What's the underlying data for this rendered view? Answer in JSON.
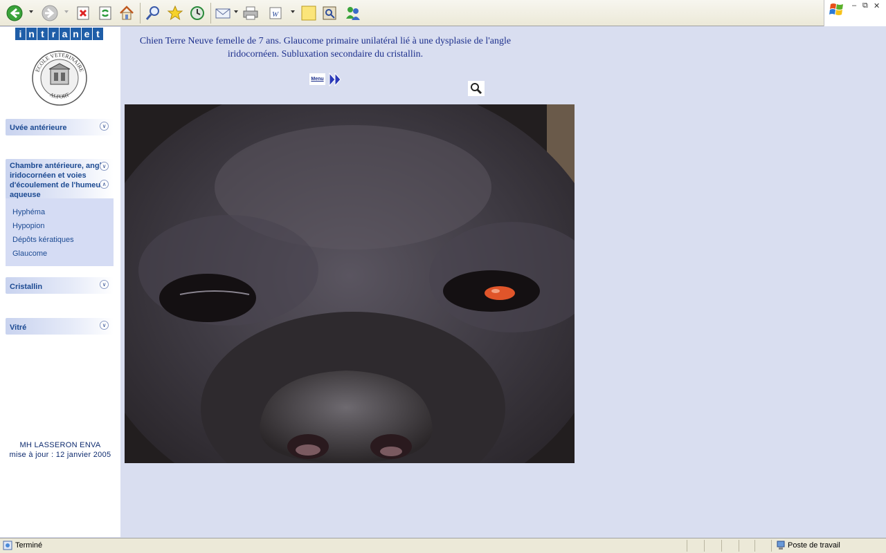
{
  "toolbar": {
    "buttons": [
      "back-icon",
      "forward-icon",
      "stop-icon",
      "refresh-icon",
      "home-icon",
      "search-icon",
      "favorites-icon",
      "history-icon",
      "mail-icon",
      "print-icon",
      "edit-icon",
      "discuss-icon",
      "research-icon",
      "messenger-icon"
    ]
  },
  "sidebar": {
    "intranet_letters": [
      "i",
      "n",
      "t",
      "r",
      "a",
      "n",
      "e",
      "t"
    ],
    "logo_top_text": "ECOLE VETERINAIRE",
    "logo_bottom_text": "ALFORT",
    "sections": [
      {
        "label": "Uvée antérieure"
      },
      {
        "label": "Chambre antérieure, angle iridocornéen et voies d'écoulement de l'humeur aqueuse"
      },
      {
        "label": "Cristallin"
      },
      {
        "label": "Vitré"
      }
    ],
    "sub_items": [
      "Hyphéma",
      "Hypopion",
      "Dépôts kératiques",
      "Glaucome"
    ],
    "credit_author": "MH LASSERON ENVA",
    "credit_update": "mise à jour : 12 janvier 2005"
  },
  "main": {
    "caption_line1": "Chien Terre Neuve femelle de 7 ans. Glaucome primaire unilatéral lié à une dysplasie de l'angle",
    "caption_line2": "iridocornéen. Subluxation secondaire du cristallin.",
    "menu_label": "Menu"
  },
  "statusbar": {
    "status_text": "Terminé",
    "zone_text": "Poste de travail"
  },
  "colors": {
    "accent": "#1c4a92",
    "content_bg": "#d9def0",
    "intranet_blue": "#1f5ea8"
  }
}
